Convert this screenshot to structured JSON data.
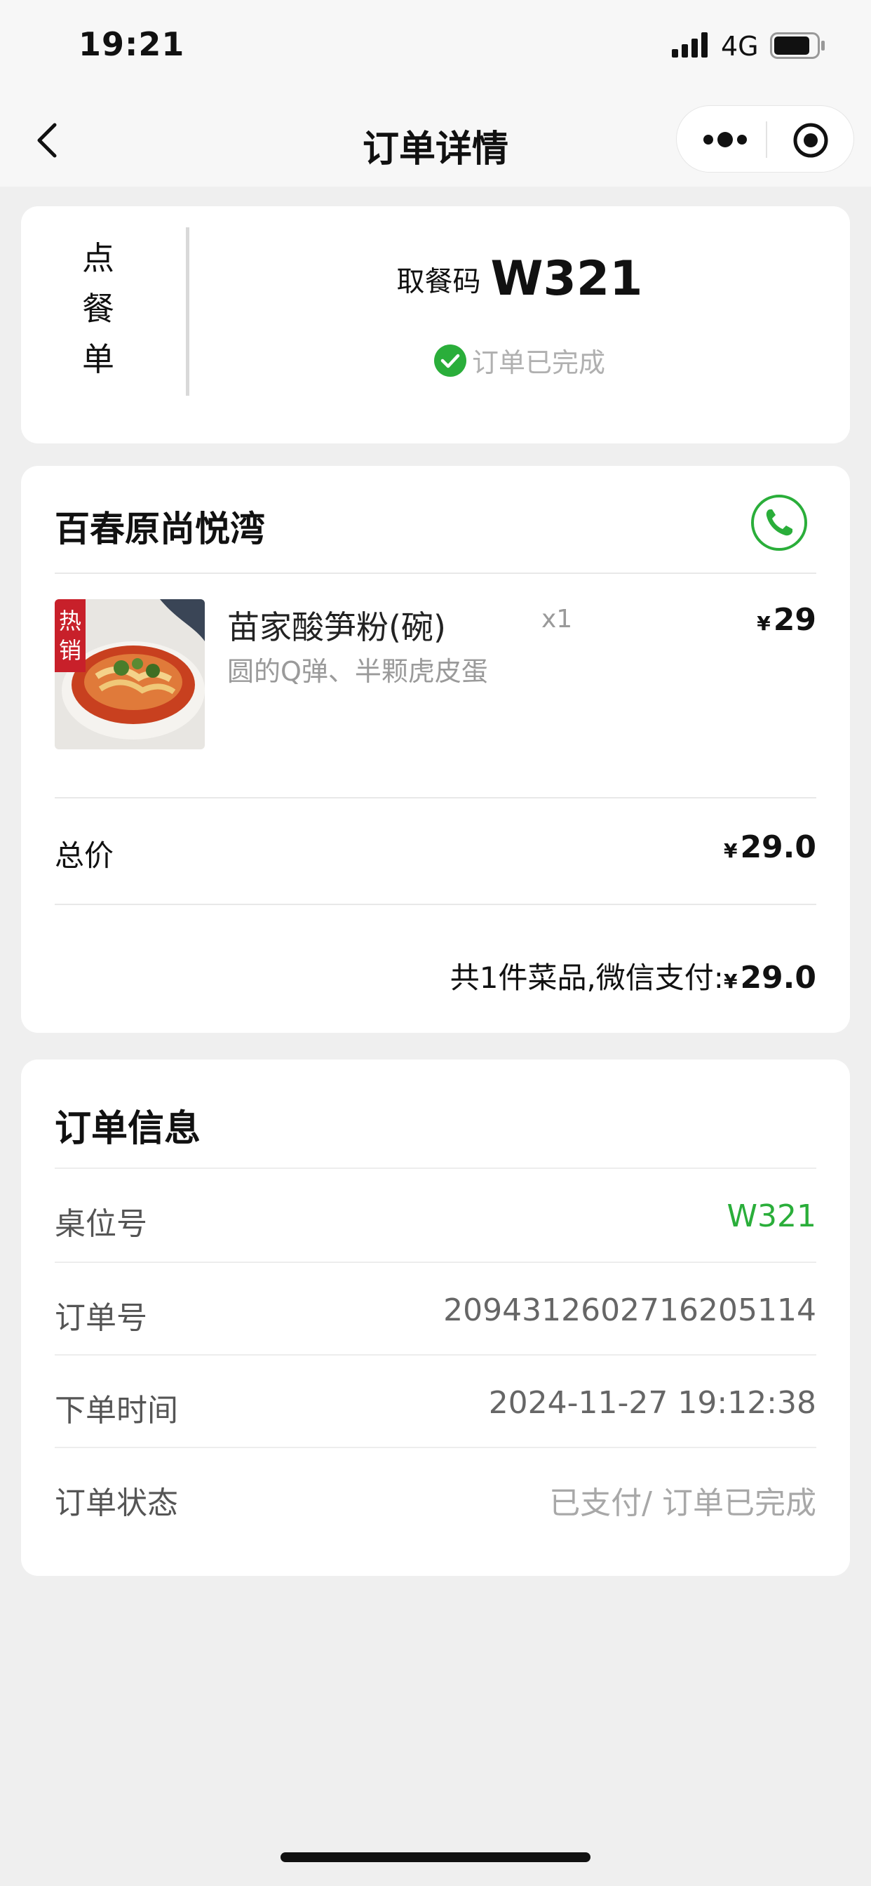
{
  "status_bar": {
    "time": "19:21",
    "network": "4G",
    "icons": [
      "signal-icon",
      "battery-icon"
    ]
  },
  "nav": {
    "title": "订单详情",
    "icons": [
      "back-icon",
      "more-icon",
      "close-icon"
    ]
  },
  "pickup": {
    "vertical_label": [
      "点",
      "餐",
      "单"
    ],
    "code_label": "取餐码",
    "code": "W321",
    "status": "订单已完成",
    "status_icon": "check-circle-icon"
  },
  "order": {
    "store_name": "百春原尚悦湾",
    "phone_icon": "phone-icon",
    "items": [
      {
        "name": "苗家酸笋粉(碗)",
        "desc": "圆的Q弹、半颗虎皮蛋",
        "qty": "x1",
        "currency": "¥",
        "price": "29",
        "thumb_badge": "热销"
      }
    ],
    "total_label": "总价",
    "total_currency": "¥",
    "total_value": "29.0",
    "summary_text": "共1件菜品,微信支付:",
    "summary_currency": "¥",
    "summary_amount": "29.0"
  },
  "info": {
    "title": "订单信息",
    "rows": [
      {
        "label": "桌位号",
        "value": "W321"
      },
      {
        "label": "订单号",
        "value": "2094312602716205114"
      },
      {
        "label": "下单时间",
        "value": "2024-11-27 19:12:38"
      },
      {
        "label": "订单状态",
        "value": "已支付/ 订单已完成"
      }
    ]
  },
  "colors": {
    "accent_green": "#2aae3a",
    "page_bg": "#efefef",
    "card_bg": "#ffffff"
  }
}
